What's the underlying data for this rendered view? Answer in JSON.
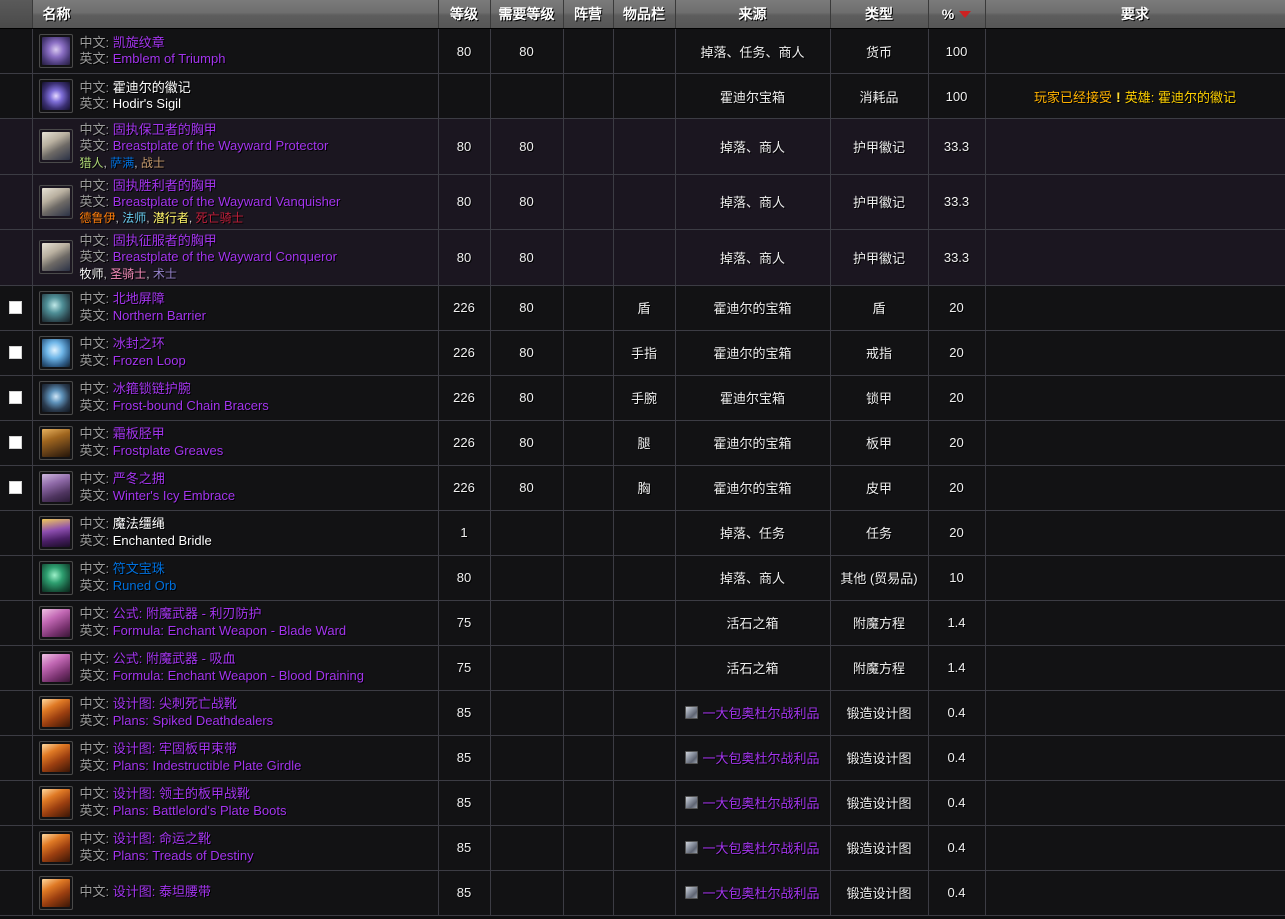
{
  "table": {
    "columns": [
      {
        "key": "check",
        "label": ""
      },
      {
        "key": "name",
        "label": "名称"
      },
      {
        "key": "level",
        "label": "等级"
      },
      {
        "key": "reqlevel",
        "label": "需要等级"
      },
      {
        "key": "faction",
        "label": "阵营"
      },
      {
        "key": "slot",
        "label": "物品栏"
      },
      {
        "key": "source",
        "label": "来源"
      },
      {
        "key": "type",
        "label": "类型"
      },
      {
        "key": "pct",
        "label": "%"
      },
      {
        "key": "requires",
        "label": "要求"
      }
    ],
    "sort": {
      "column": "%",
      "direction": "desc",
      "indicator": "sort-desc-arrow",
      "color": "#cc2222"
    },
    "labels": {
      "cn": "中文:",
      "en": "英文:"
    },
    "rows": [
      {
        "checkbox": false,
        "icon": {
          "name": "emblem-of-triumph-icon",
          "bg": "radial-gradient(circle at 50% 45%,#d8c9ef 0%,#8b6fc4 35%,#4a3a78 70%,#241c3c 100%)"
        },
        "cn": "凯旋纹章",
        "en": "Emblem of Triumph",
        "quality": "q-epic",
        "classes": [],
        "level": "80",
        "reqlevel": "80",
        "faction": "",
        "slot": "",
        "source": "掉落、任务、商人",
        "source_link": false,
        "type": "货币",
        "pct": "100",
        "requires": null,
        "tinted": false
      },
      {
        "checkbox": false,
        "icon": {
          "name": "hodirs-sigil-icon",
          "bg": "radial-gradient(circle at 50% 50%,#e6d9ff 0%,#7f6fd8 30%,#3a2f72 65%,#15112c 100%)"
        },
        "cn": "霍迪尔的徽记",
        "en": "Hodir's Sigil",
        "quality": "q-common",
        "classes": [],
        "level": "",
        "reqlevel": "",
        "faction": "",
        "slot": "",
        "source": "霍迪尔宝箱",
        "source_link": false,
        "type": "消耗品",
        "pct": "100",
        "requires": {
          "prefix": "玩家已经接受",
          "icon": "quest-exclamation-icon",
          "link": "英雄: 霍迪尔的徽记"
        },
        "tinted": false
      },
      {
        "checkbox": false,
        "icon": {
          "name": "breastplate-wayward-protector-icon",
          "bg": "linear-gradient(150deg,#e8e3d6 0%,#b9b0a0 35%,#6e6a66 60%,#2b3246 100%)"
        },
        "cn": "固执保卫者的胸甲",
        "en": "Breastplate of the Wayward Protector",
        "quality": "q-epic",
        "classes": [
          {
            "label": "猎人",
            "color": "#abd473"
          },
          {
            "label": "萨满",
            "color": "#0070de"
          },
          {
            "label": "战士",
            "color": "#c79c6e"
          }
        ],
        "level": "80",
        "reqlevel": "80",
        "faction": "",
        "slot": "",
        "source": "掉落、商人",
        "source_link": false,
        "type": "护甲徽记",
        "pct": "33.3",
        "requires": null,
        "tinted": true
      },
      {
        "checkbox": false,
        "icon": {
          "name": "breastplate-wayward-vanquisher-icon",
          "bg": "linear-gradient(150deg,#e8e3d6 0%,#b9b0a0 35%,#6e6a66 60%,#2b3246 100%)"
        },
        "cn": "固执胜利者的胸甲",
        "en": "Breastplate of the Wayward Vanquisher",
        "quality": "q-epic",
        "classes": [
          {
            "label": "德鲁伊",
            "color": "#ff7d0a"
          },
          {
            "label": "法师",
            "color": "#69ccf0"
          },
          {
            "label": "潜行者",
            "color": "#fff569"
          },
          {
            "label": "死亡骑士",
            "color": "#c41f3b"
          }
        ],
        "level": "80",
        "reqlevel": "80",
        "faction": "",
        "slot": "",
        "source": "掉落、商人",
        "source_link": false,
        "type": "护甲徽记",
        "pct": "33.3",
        "requires": null,
        "tinted": true
      },
      {
        "checkbox": false,
        "icon": {
          "name": "breastplate-wayward-conqueror-icon",
          "bg": "linear-gradient(150deg,#e8e3d6 0%,#b9b0a0 35%,#6e6a66 60%,#2b3246 100%)"
        },
        "cn": "固执征服者的胸甲",
        "en": "Breastplate of the Wayward Conqueror",
        "quality": "q-epic",
        "classes": [
          {
            "label": "牧师",
            "color": "#ffffff"
          },
          {
            "label": "圣骑士",
            "color": "#f58cba"
          },
          {
            "label": "术士",
            "color": "#9482c9"
          }
        ],
        "level": "80",
        "reqlevel": "80",
        "faction": "",
        "slot": "",
        "source": "掉落、商人",
        "source_link": false,
        "type": "护甲徽记",
        "pct": "33.3",
        "requires": null,
        "tinted": true
      },
      {
        "checkbox": true,
        "icon": {
          "name": "northern-barrier-icon",
          "bg": "radial-gradient(circle at 45% 40%,#bfe8e8 0%,#4f8f97 35%,#2d4a52 70%,#171d22 100%)"
        },
        "cn": "北地屏障",
        "en": "Northern Barrier",
        "quality": "q-epic",
        "classes": [],
        "level": "226",
        "reqlevel": "80",
        "faction": "",
        "slot": "盾",
        "source": "霍迪尔的宝箱",
        "source_link": false,
        "type": "盾",
        "pct": "20",
        "requires": null,
        "tinted": false
      },
      {
        "checkbox": true,
        "icon": {
          "name": "frozen-loop-icon",
          "bg": "radial-gradient(circle at 45% 40%,#dff2ff 0%,#6fb6e8 35%,#2f5d88 70%,#14202c 100%)"
        },
        "cn": "冰封之环",
        "en": "Frozen Loop",
        "quality": "q-epic",
        "classes": [],
        "level": "226",
        "reqlevel": "80",
        "faction": "",
        "slot": "手指",
        "source": "霍迪尔的宝箱",
        "source_link": false,
        "type": "戒指",
        "pct": "20",
        "requires": null,
        "tinted": false
      },
      {
        "checkbox": true,
        "icon": {
          "name": "frost-bound-chain-bracers-icon",
          "bg": "radial-gradient(circle at 50% 45%,#cfe6f7 0%,#5f93bb 30%,#2b3c50 65%,#10161e 100%)"
        },
        "cn": "冰箍锁链护腕",
        "en": "Frost-bound Chain Bracers",
        "quality": "q-epic",
        "classes": [],
        "level": "226",
        "reqlevel": "80",
        "faction": "",
        "slot": "手腕",
        "source": "霍迪尔宝箱",
        "source_link": false,
        "type": "锁甲",
        "pct": "20",
        "requires": null,
        "tinted": false
      },
      {
        "checkbox": true,
        "icon": {
          "name": "frostplate-greaves-icon",
          "bg": "linear-gradient(160deg,#e8b25f 0%,#a0661f 35%,#5c3a16 70%,#241508 100%)"
        },
        "cn": "霜板胫甲",
        "en": "Frostplate Greaves",
        "quality": "q-epic",
        "classes": [],
        "level": "226",
        "reqlevel": "80",
        "faction": "",
        "slot": "腿",
        "source": "霍迪尔的宝箱",
        "source_link": false,
        "type": "板甲",
        "pct": "20",
        "requires": null,
        "tinted": false
      },
      {
        "checkbox": true,
        "icon": {
          "name": "winters-icy-embrace-icon",
          "bg": "linear-gradient(160deg,#cdb7df 0%,#8f6aa8 35%,#4f3560 70%,#2a1b36 100%)"
        },
        "cn": "严冬之拥",
        "en": "Winter's Icy Embrace",
        "quality": "q-epic",
        "classes": [],
        "level": "226",
        "reqlevel": "80",
        "faction": "",
        "slot": "胸",
        "source": "霍迪尔的宝箱",
        "source_link": false,
        "type": "皮甲",
        "pct": "20",
        "requires": null,
        "tinted": false
      },
      {
        "checkbox": false,
        "icon": {
          "name": "enchanted-bridle-icon",
          "bg": "linear-gradient(170deg,#f0c85a 0%,#8e4fb0 40%,#4a1f66 70%,#1c0e28 100%)"
        },
        "cn": "魔法缰绳",
        "en": "Enchanted Bridle",
        "quality": "q-common",
        "classes": [],
        "level": "1",
        "reqlevel": "",
        "faction": "",
        "slot": "",
        "source": "掉落、任务",
        "source_link": false,
        "type": "任务",
        "pct": "20",
        "requires": null,
        "tinted": false
      },
      {
        "checkbox": false,
        "icon": {
          "name": "runed-orb-icon",
          "bg": "radial-gradient(circle at 45% 40%,#9cf0c8 0%,#2e9f70 35%,#17553c 70%,#0a2319 100%)"
        },
        "cn": "符文宝珠",
        "en": "Runed Orb",
        "quality": "q-rare",
        "classes": [],
        "level": "80",
        "reqlevel": "",
        "faction": "",
        "slot": "",
        "source": "掉落、商人",
        "source_link": false,
        "type": "其他 (贸易品)",
        "pct": "10",
        "requires": null,
        "tinted": false
      },
      {
        "checkbox": false,
        "icon": {
          "name": "formula-blade-ward-icon",
          "bg": "linear-gradient(150deg,#f0c2e4 0%,#c268b4 35%,#7a3370 70%,#3a1636 100%)"
        },
        "cn": "公式: 附魔武器 - 利刃防护",
        "en": "Formula: Enchant Weapon - Blade Ward",
        "quality": "q-epic",
        "classes": [],
        "level": "75",
        "reqlevel": "",
        "faction": "",
        "slot": "",
        "source": "活石之箱",
        "source_link": false,
        "type": "附魔方程",
        "pct": "1.4",
        "requires": null,
        "tinted": false
      },
      {
        "checkbox": false,
        "icon": {
          "name": "formula-blood-draining-icon",
          "bg": "linear-gradient(150deg,#f0c2e4 0%,#c268b4 35%,#7a3370 70%,#3a1636 100%)"
        },
        "cn": "公式: 附魔武器 - 吸血",
        "en": "Formula: Enchant Weapon - Blood Draining",
        "quality": "q-epic",
        "classes": [],
        "level": "75",
        "reqlevel": "",
        "faction": "",
        "slot": "",
        "source": "活石之箱",
        "source_link": false,
        "type": "附魔方程",
        "pct": "1.4",
        "requires": null,
        "tinted": false
      },
      {
        "checkbox": false,
        "icon": {
          "name": "plans-spiked-deathdealers-icon",
          "bg": "linear-gradient(150deg,#ffd9a0 0%,#e07a25 30%,#9c3f10 60%,#3a1606 100%)"
        },
        "cn": "设计图: 尖刺死亡战靴",
        "en": "Plans: Spiked Deathdealers",
        "quality": "q-epic",
        "classes": [],
        "level": "85",
        "reqlevel": "",
        "faction": "",
        "slot": "",
        "source": "一大包奥杜尔战利品",
        "source_link": true,
        "source_quality": "q-epic",
        "type": "锻造设计图",
        "pct": "0.4",
        "requires": null,
        "tinted": false
      },
      {
        "checkbox": false,
        "icon": {
          "name": "plans-indestructible-plate-girdle-icon",
          "bg": "linear-gradient(150deg,#ffd9a0 0%,#e07a25 30%,#9c3f10 60%,#3a1606 100%)"
        },
        "cn": "设计图: 牢固板甲束带",
        "en": "Plans: Indestructible Plate Girdle",
        "quality": "q-epic",
        "classes": [],
        "level": "85",
        "reqlevel": "",
        "faction": "",
        "slot": "",
        "source": "一大包奥杜尔战利品",
        "source_link": true,
        "source_quality": "q-epic",
        "type": "锻造设计图",
        "pct": "0.4",
        "requires": null,
        "tinted": false
      },
      {
        "checkbox": false,
        "icon": {
          "name": "plans-battlelords-plate-boots-icon",
          "bg": "linear-gradient(150deg,#ffd9a0 0%,#e07a25 30%,#9c3f10 60%,#3a1606 100%)"
        },
        "cn": "设计图: 领主的板甲战靴",
        "en": "Plans: Battlelord's Plate Boots",
        "quality": "q-epic",
        "classes": [],
        "level": "85",
        "reqlevel": "",
        "faction": "",
        "slot": "",
        "source": "一大包奥杜尔战利品",
        "source_link": true,
        "source_quality": "q-epic",
        "type": "锻造设计图",
        "pct": "0.4",
        "requires": null,
        "tinted": false
      },
      {
        "checkbox": false,
        "icon": {
          "name": "plans-treads-of-destiny-icon",
          "bg": "linear-gradient(150deg,#ffd9a0 0%,#e07a25 30%,#9c3f10 60%,#3a1606 100%)"
        },
        "cn": "设计图: 命运之靴",
        "en": "Plans: Treads of Destiny",
        "quality": "q-epic",
        "classes": [],
        "level": "85",
        "reqlevel": "",
        "faction": "",
        "slot": "",
        "source": "一大包奥杜尔战利品",
        "source_link": true,
        "source_quality": "q-epic",
        "type": "锻造设计图",
        "pct": "0.4",
        "requires": null,
        "tinted": false
      },
      {
        "checkbox": false,
        "icon": {
          "name": "plans-titanium-belt-icon",
          "bg": "linear-gradient(150deg,#ffd9a0 0%,#e07a25 30%,#9c3f10 60%,#3a1606 100%)"
        },
        "cn": "设计图: 泰坦腰带",
        "en": "",
        "quality": "q-epic",
        "classes": [],
        "level": "85",
        "reqlevel": "",
        "faction": "",
        "slot": "",
        "source": "一大包奥杜尔战利品",
        "source_link": true,
        "source_quality": "q-epic",
        "type": "锻造设计图",
        "pct": "0.4",
        "requires": null,
        "tinted": false
      }
    ]
  }
}
